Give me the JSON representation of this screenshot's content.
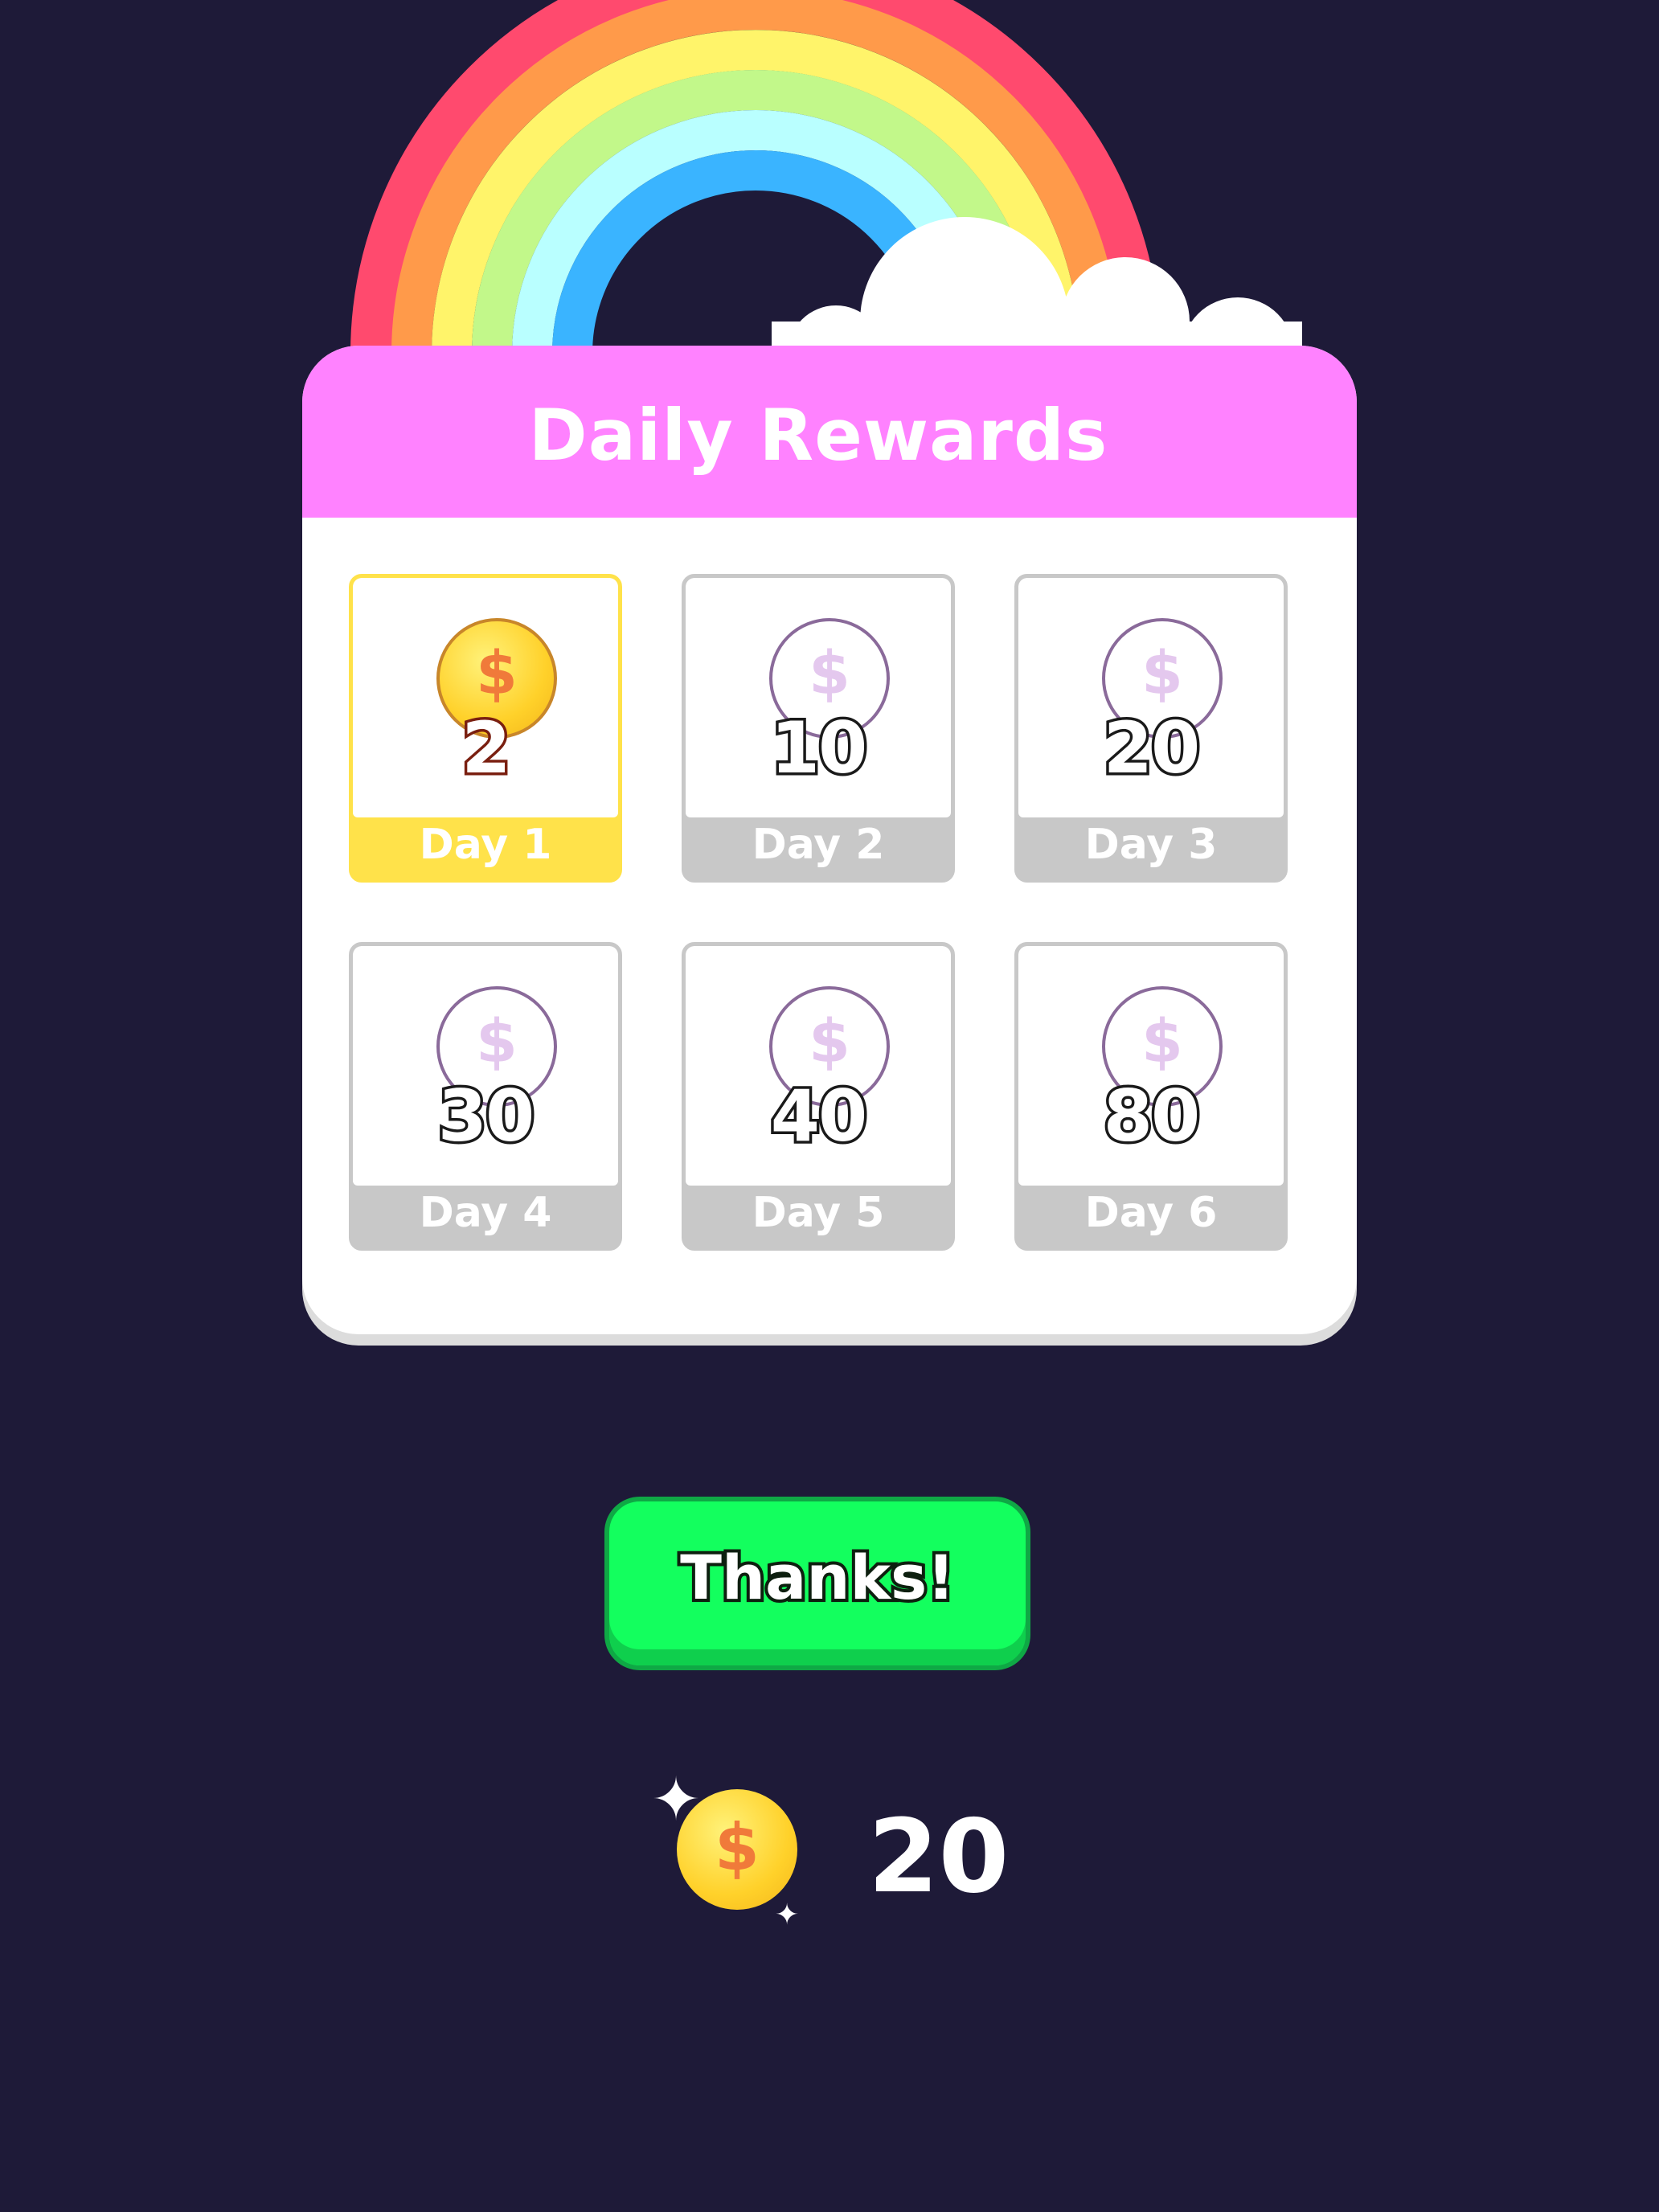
{
  "title": "Daily Rewards",
  "days": [
    {
      "label": "Day 1",
      "amount": "2",
      "state": "active"
    },
    {
      "label": "Day 2",
      "amount": "10",
      "state": "locked"
    },
    {
      "label": "Day 3",
      "amount": "20",
      "state": "locked"
    },
    {
      "label": "Day 4",
      "amount": "30",
      "state": "locked"
    },
    {
      "label": "Day 5",
      "amount": "40",
      "state": "locked"
    },
    {
      "label": "Day 6",
      "amount": "80",
      "state": "locked"
    }
  ],
  "coin_symbol": "$",
  "button": {
    "label": "Thanks!"
  },
  "balance": {
    "value": "20",
    "icon": "coin-icon"
  },
  "colors": {
    "background": "#1e1a38",
    "header": "#ff82ff",
    "active": "#ffe24a",
    "inactive": "#c8c8c8",
    "button": "#13ff5e"
  }
}
